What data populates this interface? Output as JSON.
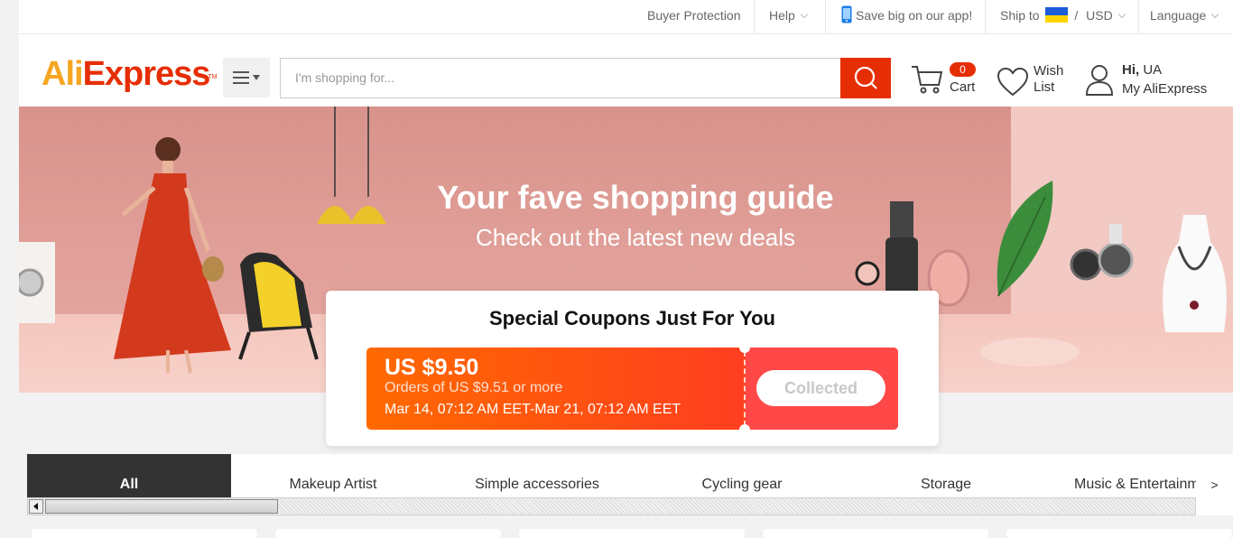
{
  "topbar": {
    "buyer_protection": "Buyer Protection",
    "help": "Help",
    "app_promo": "Save big on our app!",
    "ship_to": "Ship to",
    "slash": "/",
    "currency": "USD",
    "language": "Language"
  },
  "header": {
    "logo_ali": "Ali",
    "logo_express": "Express",
    "logo_tm": "TM",
    "search_placeholder": "I'm shopping for...",
    "cart_count": "0",
    "cart_label": "Cart",
    "wish_line1": "Wish",
    "wish_line2": "List",
    "greeting_hi": "Hi,",
    "greeting_user": "UA",
    "account_label": "My AliExpress"
  },
  "banner": {
    "title": "Your fave shopping guide",
    "subtitle": "Check out the latest new deals"
  },
  "coupon": {
    "heading": "Special Coupons Just For You",
    "amount": "US $9.50",
    "condition": "Orders of US $9.51 or more",
    "validity": "Mar 14, 07:12 AM EET-Mar 21, 07:12 AM EET",
    "button": "Collected"
  },
  "tabs": {
    "items": [
      "All",
      "Makeup Artist",
      "Simple accessories",
      "Cycling gear",
      "Storage",
      "Music & Entertainment"
    ],
    "next": ">"
  },
  "colors": {
    "brand": "#e62e04",
    "logo_orange": "#f5a623",
    "coupon_gradient_start": "#ff6a00",
    "coupon_gradient_end": "#ff4848"
  }
}
